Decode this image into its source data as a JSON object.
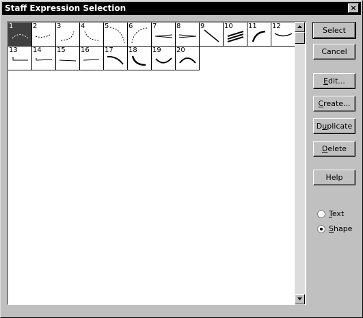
{
  "window": {
    "title": "Staff Expression Selection",
    "close_glyph": "×"
  },
  "cells": [
    {
      "num": "1",
      "shape": "dash-arc-down"
    },
    {
      "num": "2",
      "shape": "dash-arc-down-right"
    },
    {
      "num": "3",
      "shape": "dash-curve-up"
    },
    {
      "num": "4",
      "shape": "dash-curve-down"
    },
    {
      "num": "5",
      "shape": "dash-arc-quarter"
    },
    {
      "num": "6",
      "shape": "dash-arc-quarter-left"
    },
    {
      "num": "7",
      "shape": "hairpin-open"
    },
    {
      "num": "8",
      "shape": "hairpin-close"
    },
    {
      "num": "9",
      "shape": "diagonal-line"
    },
    {
      "num": "10",
      "shape": "triple-lines"
    },
    {
      "num": "11",
      "shape": "thick-arc-up"
    },
    {
      "num": "12",
      "shape": "arc-down-small"
    },
    {
      "num": "13",
      "shape": "bracket-line"
    },
    {
      "num": "14",
      "shape": "flat-line"
    },
    {
      "num": "15",
      "shape": "flat-line-low"
    },
    {
      "num": "16",
      "shape": "flat-line-short"
    },
    {
      "num": "17",
      "shape": "thick-arc-down"
    },
    {
      "num": "18",
      "shape": "thick-arc-curl"
    },
    {
      "num": "19",
      "shape": "thick-smile"
    },
    {
      "num": "20",
      "shape": "thick-frown"
    }
  ],
  "buttons": {
    "select": {
      "pre": "",
      "ul": "",
      "post": "Select"
    },
    "cancel": {
      "pre": "",
      "ul": "",
      "post": "Cancel"
    },
    "edit": {
      "pre": "",
      "ul": "E",
      "post": "dit..."
    },
    "create": {
      "pre": "",
      "ul": "C",
      "post": "reate..."
    },
    "duplicate": {
      "pre": "D",
      "ul": "u",
      "post": "plicate"
    },
    "delete": {
      "pre": "",
      "ul": "D",
      "post": "elete"
    },
    "help": {
      "pre": "",
      "ul": "",
      "post": "Help"
    }
  },
  "radios": {
    "text": {
      "pre": "",
      "ul": "T",
      "post": "ext",
      "checked": false
    },
    "shape": {
      "pre": "",
      "ul": "S",
      "post": "hape",
      "checked": true
    }
  },
  "selected_index": 1
}
